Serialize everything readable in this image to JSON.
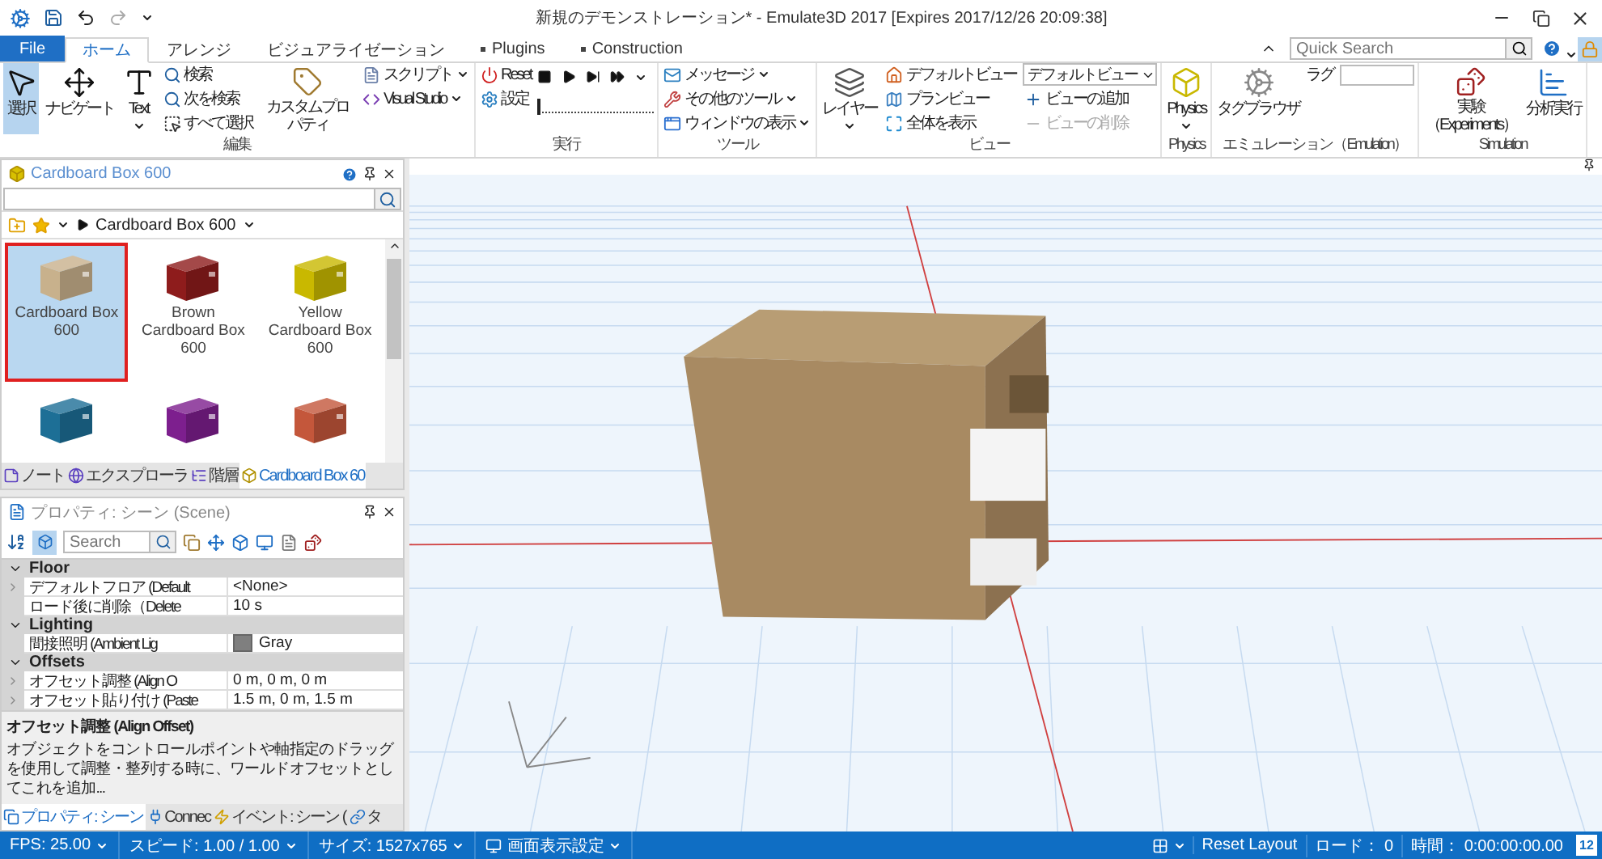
{
  "window": {
    "title": "新規のデモンストレーション* - Emulate3D 2017 [Expires 2017/12/26 20:09:38]"
  },
  "tabs": [
    {
      "label": "File",
      "kind": "file",
      "selected": false
    },
    {
      "label": "ホーム",
      "kind": "tab",
      "selected": true
    },
    {
      "label": "アレンジ",
      "kind": "tab",
      "selected": false
    },
    {
      "label": "ビジュアライゼーション",
      "kind": "tab",
      "selected": false
    },
    {
      "label": "Plugins",
      "kind": "plugin",
      "selected": false
    },
    {
      "label": "Construction",
      "kind": "plugin",
      "selected": false
    }
  ],
  "quick_search": {
    "placeholder": "Quick Search"
  },
  "ribbon_groups": [
    {
      "label": "編集",
      "columns": [
        [
          {
            "kind": "large",
            "label": "選択",
            "pressed": true
          }
        ],
        [
          {
            "kind": "large",
            "label": "ナビゲート",
            "pressed": false
          }
        ],
        [
          {
            "kind": "large",
            "label": "Text",
            "pressed": false,
            "dropdown": true
          }
        ],
        [
          {
            "kind": "small",
            "label": "検索"
          },
          {
            "kind": "small",
            "label": "次を検索"
          },
          {
            "kind": "small",
            "label": "すべて選択"
          }
        ],
        [
          {
            "kind": "large",
            "label": "カスタムプロパティ"
          }
        ],
        [
          {
            "kind": "small",
            "label": "スクリプト",
            "dropdown": true
          },
          {
            "kind": "small",
            "label": "Visual Studio",
            "dropdown": true
          }
        ]
      ]
    },
    {
      "label": "実行",
      "columns": [
        [
          {
            "kind": "small",
            "label": "Reset"
          },
          {
            "kind": "small",
            "label": "設定"
          }
        ],
        [
          {
            "kind": "player",
            "dropdown": true
          },
          {
            "kind": "slider",
            "level": 0
          }
        ]
      ]
    },
    {
      "label": "ツール",
      "columns": [
        [
          {
            "kind": "small",
            "label": "メッセージ",
            "dropdown": true
          },
          {
            "kind": "small",
            "label": "その他のツール",
            "dropdown": true
          },
          {
            "kind": "small",
            "label": "ウィンドウの表示",
            "dropdown": true
          }
        ]
      ]
    },
    {
      "label": "ビュー",
      "columns": [
        [
          {
            "kind": "large",
            "label": "レイヤー",
            "dropdown": true
          }
        ],
        [
          {
            "kind": "small",
            "label": "デフォルトビュー"
          },
          {
            "kind": "small",
            "label": "プランビュー"
          },
          {
            "kind": "small",
            "label": "全体を表示"
          }
        ],
        [
          {
            "kind": "combo",
            "label": "デフォルトビュー"
          },
          {
            "kind": "small",
            "label": "ビューの追加"
          },
          {
            "kind": "small",
            "label": "ビューの削除",
            "disabled": true
          }
        ]
      ]
    },
    {
      "label": "Physics",
      "columns": [
        [
          {
            "kind": "large",
            "label": "Physics",
            "dropdown": true
          }
        ]
      ]
    },
    {
      "label": "エミュレーション（Emulation）",
      "columns": [
        [
          {
            "kind": "large",
            "label": "タグブラウザ"
          }
        ],
        [
          {
            "kind": "field",
            "label": "ラグ"
          }
        ]
      ]
    },
    {
      "label": "Simulation",
      "columns": [
        [
          {
            "kind": "large",
            "label": "実験（Experiments）"
          }
        ],
        [
          {
            "kind": "large",
            "label": "分析実行"
          }
        ]
      ]
    }
  ],
  "catalog": {
    "title": "Cardboard Box 600",
    "breadcrumb": "Cardboard Box 600",
    "items": [
      {
        "label": "Cardboard Box 600",
        "color": "#c8b18c",
        "selected": true
      },
      {
        "label": "Brown Cardboard Box 600",
        "color": "#8e1c1c",
        "selected": false
      },
      {
        "label": "Yellow Cardboard Box 600",
        "color": "#c9b800",
        "selected": false
      },
      {
        "color": "#1d6f96",
        "selected": false
      },
      {
        "color": "#7d1f8e",
        "selected": false
      },
      {
        "color": "#c4573b",
        "selected": false
      }
    ],
    "tabs": [
      {
        "label": "ノート",
        "selected": false
      },
      {
        "label": "エクスプローラ",
        "selected": false
      },
      {
        "label": "階層",
        "selected": false
      },
      {
        "label": "Cardboard Box 60",
        "selected": true
      }
    ]
  },
  "properties": {
    "title": "プロパティ: シーン (Scene)",
    "search": {
      "placeholder": "Search"
    },
    "categories": [
      {
        "name": "Floor",
        "expanded": true,
        "rows": [
          {
            "name": "デフォルトフロア (Default",
            "value": "<None>",
            "expandable": true
          },
          {
            "name": "ロード後に削除（Delete",
            "value": "10 s",
            "expandable": false
          }
        ]
      },
      {
        "name": "Lighting",
        "expanded": true,
        "rows": [
          {
            "name": "間接照明 (Ambient Lig",
            "value": "Gray",
            "expandable": false,
            "color": "#7f7f7f"
          }
        ]
      },
      {
        "name": "Offsets",
        "expanded": true,
        "rows": [
          {
            "name": "オフセット調整 (Align O",
            "value": "0 m, 0 m, 0 m",
            "expandable": true
          },
          {
            "name": "オフセット貼り付け (Paste",
            "value": "1.5 m, 0 m, 1.5 m",
            "expandable": true
          }
        ]
      }
    ],
    "description": {
      "title": "オフセット調整 (Align Offset)",
      "text": "オブジェクトをコントロールポイントや軸指定のドラッグを使用して調整・整列する時に、ワールドオフセットとしてこれを追加..."
    },
    "tabs": [
      {
        "label": "プロパティ: シーン",
        "selected": true
      },
      {
        "label": "Connec",
        "selected": false
      },
      {
        "label": "イベント: シーン (",
        "selected": false
      },
      {
        "label": "タ",
        "selected": false
      }
    ]
  },
  "status_bar": {
    "left": [
      {
        "label": "FPS: 25.00",
        "dropdown": true
      },
      {
        "label": "スピード: 1.00 / 1.00",
        "dropdown": true
      },
      {
        "label": "サイズ: 1527x765",
        "dropdown": true
      },
      {
        "label": "画面表示設定",
        "dropdown": true,
        "kind": "display"
      }
    ],
    "right": [
      {
        "kind": "layout",
        "dropdown": true
      },
      {
        "kind": "text",
        "label": "Reset Layout"
      },
      {
        "kind": "text",
        "label": "ロード： 0"
      },
      {
        "kind": "text",
        "label": "時間： 0:00:00:00.00"
      },
      {
        "kind": "calendar",
        "label": "12"
      }
    ]
  }
}
